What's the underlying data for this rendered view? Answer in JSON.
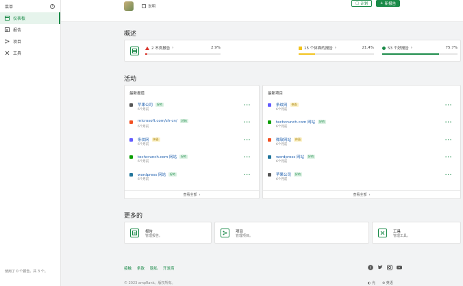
{
  "sidebar": {
    "title": "菜单",
    "items": [
      {
        "label": "仪表板",
        "icon": "dashboard-icon",
        "active": true
      },
      {
        "label": "报告",
        "icon": "report-icon",
        "active": false
      },
      {
        "label": "项目",
        "icon": "project-icon",
        "active": false
      },
      {
        "label": "工具",
        "icon": "tools-icon",
        "active": false
      }
    ],
    "footer": "使用了 0 个报告。共 3 个。"
  },
  "header": {
    "user_sub": "说明",
    "plan_label": "计划",
    "new_label": "新报告"
  },
  "overview": {
    "title": "概述",
    "items": [
      {
        "label": "2 不良报告",
        "value": "2.9%",
        "fill": 0.029,
        "color": "#d9342b",
        "marker": "triangle"
      },
      {
        "label": "15 个体面的报告",
        "value": "21.4%",
        "fill": 0.214,
        "color": "#f2c21b",
        "marker": "square"
      },
      {
        "label": "53 个好报告",
        "value": "75.7%",
        "fill": 0.757,
        "color": "#1a8a48",
        "marker": "dot"
      }
    ]
  },
  "activity": {
    "title": "活动",
    "reports": {
      "heading": "最新报道",
      "footer": "查看全部",
      "rows": [
        {
          "name": "苹果公司",
          "badge": "好的",
          "badge_color": "green",
          "time": "6个月前",
          "fav": "#555"
        },
        {
          "name": "microsoft.com/zh-cn/",
          "badge": "好的",
          "badge_color": "green",
          "time": "6个月前",
          "fav": "#f25022"
        },
        {
          "name": "条纹网",
          "badge": "体面",
          "badge_color": "yellow",
          "time": "6个月前",
          "fav": "#635bff"
        },
        {
          "name": "techcrunch.com 网站",
          "badge": "好的",
          "badge_color": "green",
          "time": "6个月前",
          "fav": "#0a9e01"
        },
        {
          "name": "wordpress 网站",
          "badge": "好的",
          "badge_color": "green",
          "time": "6个月前",
          "fav": "#21759b"
        }
      ]
    },
    "projects": {
      "heading": "最新项目",
      "footer": "查看全部",
      "rows": [
        {
          "name": "条纹网",
          "badge": "体面",
          "badge_color": "yellow",
          "time": "6个月前",
          "fav": "#635bff"
        },
        {
          "name": "techcrunch.com 网站",
          "badge": "好的",
          "badge_color": "green",
          "time": "6个月前",
          "fav": "#0a9e01"
        },
        {
          "name": "微软网站",
          "badge": "体面",
          "badge_color": "yellow",
          "time": "6个月前",
          "fav": "#f25022"
        },
        {
          "name": "wordpress 网站",
          "badge": "好的",
          "badge_color": "green",
          "time": "6个月前",
          "fav": "#21759b"
        },
        {
          "name": "苹果公司",
          "badge": "好的",
          "badge_color": "green",
          "time": "6个月前",
          "fav": "#555"
        }
      ]
    },
    "more_label": "•••"
  },
  "more": {
    "title": "更多的",
    "cards": [
      {
        "title": "报告",
        "desc": "管理报告。",
        "icon": "report-icon"
      },
      {
        "title": "项目",
        "desc": "管理项目。",
        "icon": "project-icon"
      },
      {
        "title": "工具",
        "desc": "管理工具。",
        "icon": "tools-icon"
      }
    ]
  },
  "footer": {
    "links": [
      "接触",
      "条款",
      "隐私",
      "开发商"
    ],
    "copyright": "© 2023 ampRank。版权所有。",
    "social": [
      "facebook-icon",
      "twitter-icon",
      "instagram-icon",
      "youtube-icon"
    ],
    "theme_label": "光",
    "lang_label": "英语"
  }
}
